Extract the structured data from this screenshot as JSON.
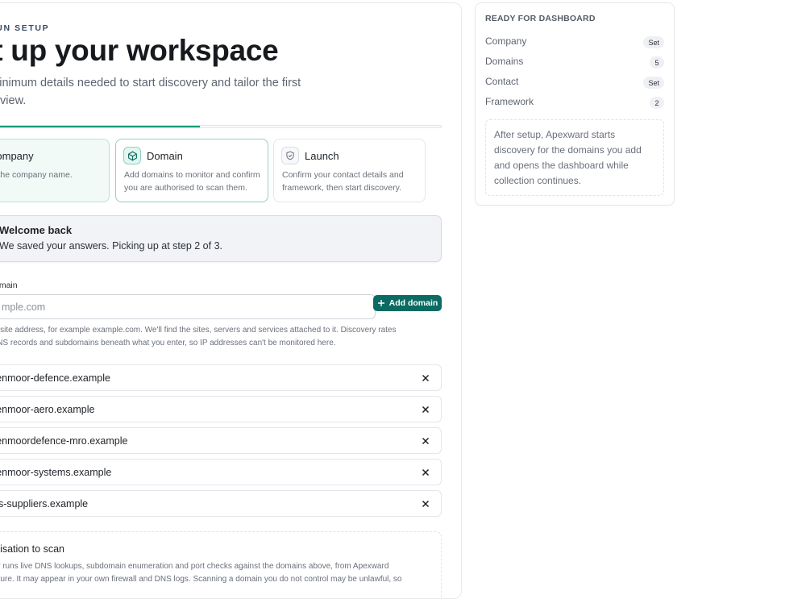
{
  "header": {
    "kicker": "-RUN SETUP",
    "title": "et up your workspace",
    "subtitle": "he minimum details needed to start discovery and tailor the first oard view."
  },
  "progress": {
    "value_percent": 47,
    "color": "#0f9b7a"
  },
  "steps": [
    {
      "title": "Company",
      "desc": "irm the company name.",
      "state": "done",
      "icon": "check-icon"
    },
    {
      "title": "Domain",
      "desc": "Add domains to monitor and confirm you are authorised to scan them.",
      "state": "active",
      "icon": "globe-icon"
    },
    {
      "title": "Launch",
      "desc": "Confirm your contact details and framework, then start discovery.",
      "state": "pending",
      "icon": "shield-icon"
    }
  ],
  "banner": {
    "title": "Welcome back",
    "text": "We saved your answers. Picking up at step 2 of 3."
  },
  "domain_form": {
    "label": "omain",
    "placeholder": "mple.com",
    "value": "",
    "add_label": "Add domain",
    "help": "ebsite address, for example example.com. We'll find the sites, servers and services attached to it. Discovery rates DNS records and subdomains beneath what you enter, so IP addresses can't be monitored here."
  },
  "domains": [
    "wrenmoor-defence.example",
    "wrenmoor-aero.example",
    "wrenmoordefence-mro.example",
    "wrenmoor-systems.example",
    "wds-suppliers.example"
  ],
  "authorisation": {
    "title": "horisation to scan",
    "text": "overy runs live DNS lookups, subdomain enumeration and port checks against the domains above, from Apexward structure. It may appear in your own firewall and DNS logs. Scanning a domain you do not control may be unlawful, so"
  },
  "sidebar": {
    "heading": "READY FOR DASHBOARD",
    "rows": [
      {
        "label": "Company",
        "badge": "Set"
      },
      {
        "label": "Domains",
        "badge": "5"
      },
      {
        "label": "Contact",
        "badge": "Set"
      },
      {
        "label": "Framework",
        "badge": "2"
      }
    ],
    "note": "After setup, Apexward starts discovery for the domains you add and opens the dashboard while collection continues."
  },
  "colors": {
    "accent": "#0b6b62",
    "success": "#0f9b7a",
    "step_done_bg": "#f1faf7"
  }
}
